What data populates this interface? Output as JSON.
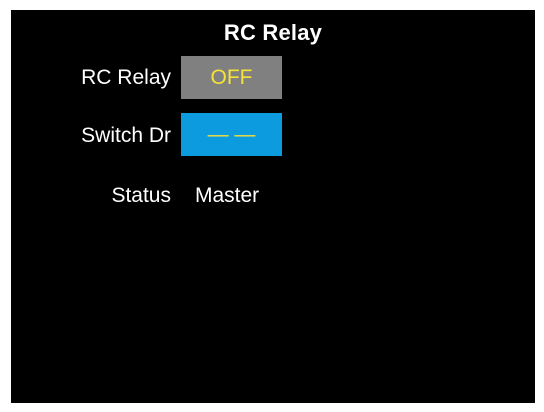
{
  "screen": {
    "title": "RC Relay",
    "rows": {
      "relay": {
        "label": "RC Relay",
        "value": "OFF",
        "bg": "#808080",
        "fg": "#f5e23a"
      },
      "switch": {
        "label": "Switch Dr",
        "value": "— —",
        "bg": "#0d9be0",
        "fg": "#f5e23a"
      },
      "status": {
        "label": "Status",
        "value": "Master"
      }
    }
  }
}
